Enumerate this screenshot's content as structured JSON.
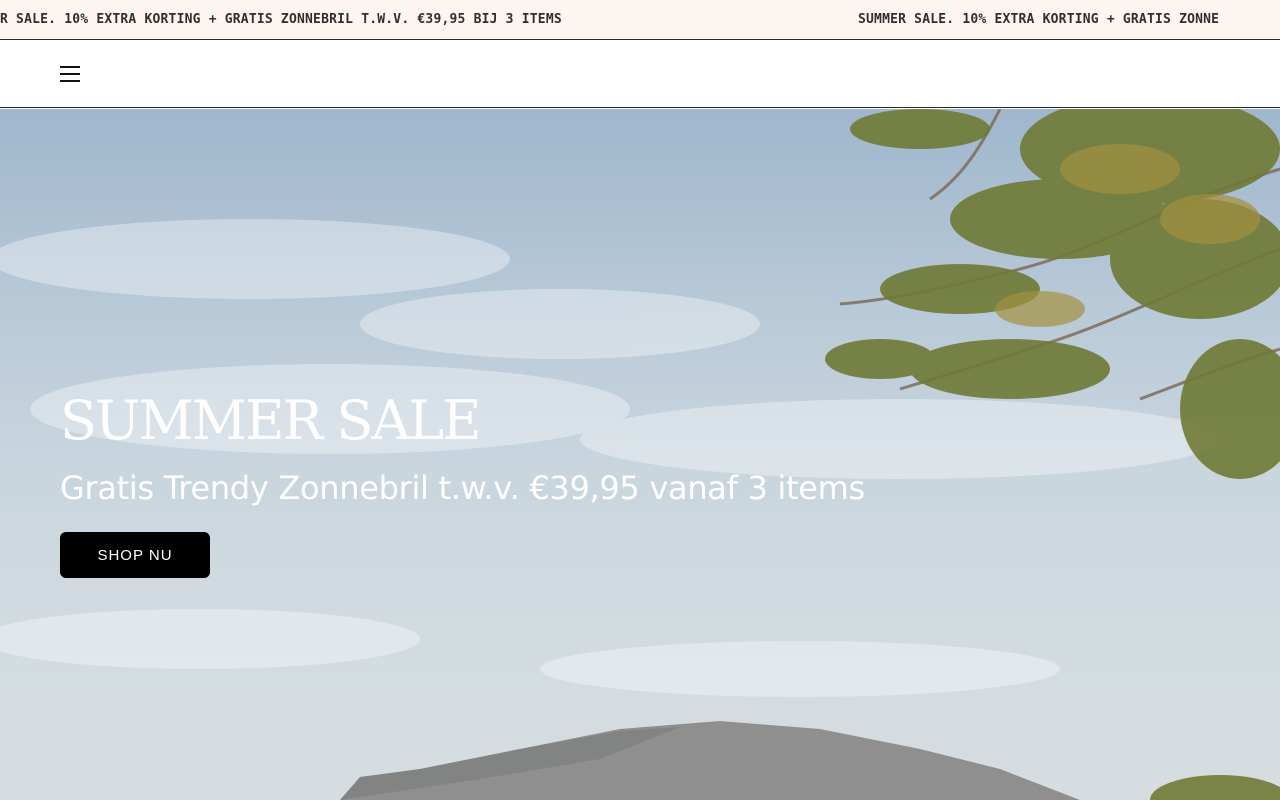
{
  "announcement_bar": {
    "text_first": "R SALE. 10% EXTRA KORTING + GRATIS ZONNEBRIL T.W.V. €39,95 BIJ 3 ITEMS",
    "text_second": "SUMMER SALE. 10% EXTRA KORTING + GRATIS ZONNE"
  },
  "header": {
    "menu_icon": "hamburger-menu-icon"
  },
  "hero": {
    "title": "SUMMER SALE",
    "subtitle": "Gratis Trendy Zonnebril t.w.v. €39,95 vanaf 3 items",
    "cta_label": "SHOP NU"
  },
  "colors": {
    "announcement_background": "#fdf5f0",
    "sky": "#b5c7d6",
    "button_background": "#000000",
    "hero_text": "#ffffff"
  }
}
